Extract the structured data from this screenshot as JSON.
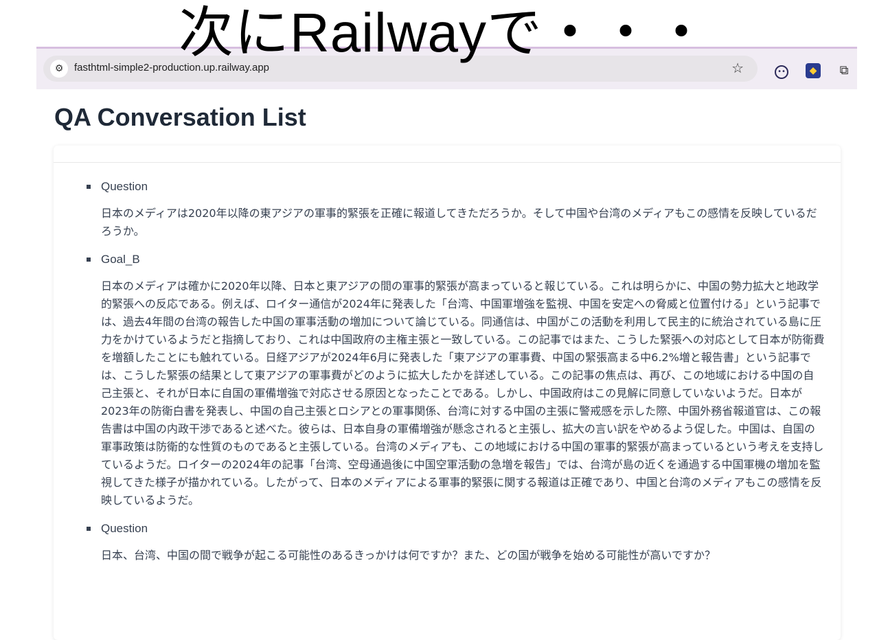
{
  "overlay": {
    "caption": "次にRailwayで・・・"
  },
  "browser": {
    "url": "fasthtml-simple2-production.up.railway.app",
    "site_icon_glyph": "⚙",
    "star_glyph": "☆",
    "extensions": [
      {
        "name": "eyes-extension",
        "glyph": "••"
      },
      {
        "name": "colorful-extension",
        "glyph": "◆"
      },
      {
        "name": "puzzle-extension",
        "glyph": "⧉"
      }
    ]
  },
  "page": {
    "title": "QA Conversation List"
  },
  "items": [
    {
      "label": "Question",
      "text": "日本のメディアは2020年以降の東アジアの軍事的緊張を正確に報道してきただろうか。そして中国や台湾のメディアもこの感情を反映しているだろうか。"
    },
    {
      "label": "Goal_B",
      "text": "日本のメディアは確かに2020年以降、日本と東アジアの間の軍事的緊張が高まっていると報じている。これは明らかに、中国の勢力拡大と地政学的緊張への反応である。例えば、ロイター通信が2024年に発表した「台湾、中国軍増強を監視、中国を安定への脅威と位置付ける」という記事では、過去4年間の台湾の報告した中国の軍事活動の増加について論じている。同通信は、中国がこの活動を利用して民主的に統治されている島に圧力をかけているようだと指摘しており、これは中国政府の主権主張と一致している。この記事ではまた、こうした緊張への対応として日本が防衛費を増額したことにも触れている。日経アジアが2024年6月に発表した「東アジアの軍事費、中国の緊張高まる中6.2%増と報告書」という記事では、こうした緊張の結果として東アジアの軍事費がどのように拡大したかを詳述している。この記事の焦点は、再び、この地域における中国の自己主張と、それが日本に自国の軍備増強で対応させる原因となったことである。しかし、中国政府はこの見解に同意していないようだ。日本が2023年の防衛白書を発表し、中国の自己主張とロシアとの軍事関係、台湾に対する中国の主張に警戒感を示した際、中国外務省報道官は、この報告書は中国の内政干渉であると述べた。彼らは、日本自身の軍備増強が懸念されると主張し、拡大の言い訳をやめるよう促した。中国は、自国の軍事政策は防衛的な性質のものであると主張している。台湾のメディアも、この地域における中国の軍事的緊張が高まっているという考えを支持しているようだ。ロイターの2024年の記事「台湾、空母通過後に中国空軍活動の急増を報告」では、台湾が島の近くを通過する中国軍機の増加を監視してきた様子が描かれている。したがって、日本のメディアによる軍事的緊張に関する報道は正確であり、中国と台湾のメディアもこの感情を反映しているようだ。"
    },
    {
      "label": "Question",
      "text": "日本、台湾、中国の間で戦争が起こる可能性のあるきっかけは何ですか？また、どの国が戦争を始める可能性が高いですか？"
    }
  ]
}
